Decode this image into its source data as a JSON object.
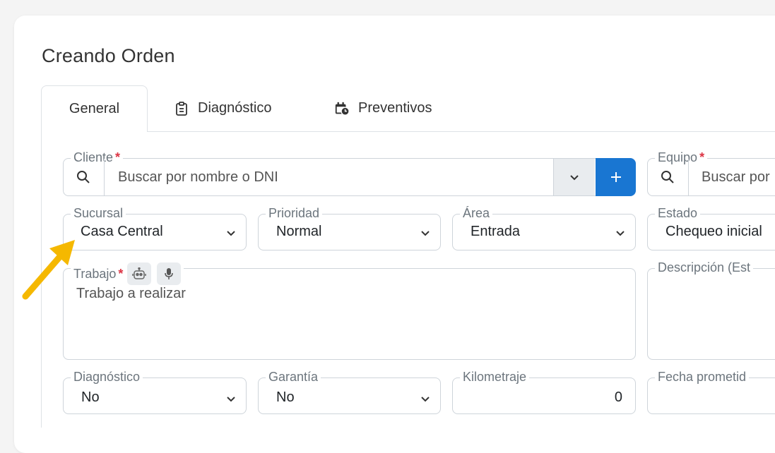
{
  "page": {
    "title": "Creando Orden"
  },
  "tabs": [
    {
      "label": "General",
      "icon": "",
      "active": true
    },
    {
      "label": "Diagnóstico",
      "icon": "clipboard-icon",
      "active": false
    },
    {
      "label": "Preventivos",
      "icon": "calendar-clock-icon",
      "active": false
    }
  ],
  "fields": {
    "cliente": {
      "label": "Cliente",
      "required": true,
      "placeholder": "Buscar por nombre o DNI"
    },
    "equipo": {
      "label": "Equipo",
      "required": true,
      "placeholder": "Buscar por"
    },
    "sucursal": {
      "label": "Sucursal",
      "value": "Casa Central"
    },
    "prioridad": {
      "label": "Prioridad",
      "value": "Normal"
    },
    "area": {
      "label": "Área",
      "value": "Entrada"
    },
    "estado": {
      "label": "Estado",
      "value": "Chequeo inicial"
    },
    "trabajo": {
      "label": "Trabajo",
      "required": true,
      "placeholder": "Trabajo a realizar"
    },
    "descripcion": {
      "label": "Descripción (Est"
    },
    "diagnostico": {
      "label": "Diagnóstico",
      "value": "No"
    },
    "garantia": {
      "label": "Garantía",
      "value": "No"
    },
    "kilometraje": {
      "label": "Kilometraje",
      "value": "0"
    },
    "fecha": {
      "label": "Fecha prometid"
    }
  },
  "colors": {
    "primary": "#1976d2",
    "required": "#dc3545",
    "arrow": "#f5b800"
  }
}
